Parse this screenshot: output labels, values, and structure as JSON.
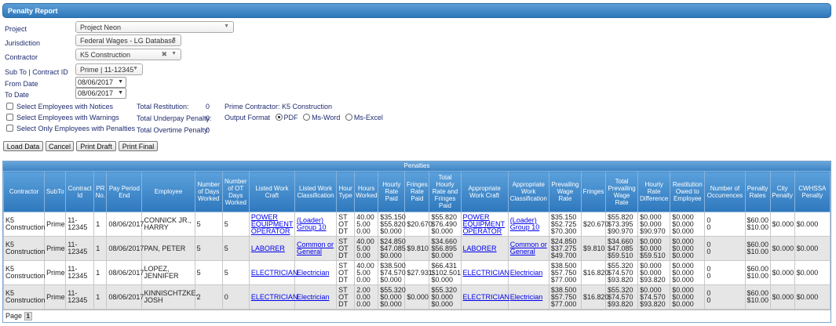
{
  "header": {
    "title": "Penalty Report"
  },
  "form": {
    "project": {
      "label": "Project",
      "value": "Project Neon"
    },
    "jurisdiction": {
      "label": "Jurisdiction",
      "value": "Federal Wages - LG Database"
    },
    "contractor": {
      "label": "Contractor",
      "value": "K5 Construction"
    },
    "subto": {
      "label": "Sub To | Contract ID",
      "value": "Prime | 11-12345"
    },
    "from_date": {
      "label": "From Date",
      "value": "08/06/2017"
    },
    "to_date": {
      "label": "To Date",
      "value": "08/06/2017"
    },
    "checks": [
      "Select Employees with Notices",
      "Select Employees with Warnings",
      "Select Only Employees with Penalties"
    ],
    "totals": [
      {
        "label": "Total Restitution:",
        "value": "0"
      },
      {
        "label": "Total Underpay Penalty:",
        "value": "0"
      },
      {
        "label": "Total Overtime Penalty:",
        "value": "0"
      }
    ],
    "prime_contractor": "Prime Contractor: K5 Construction",
    "output_format": {
      "label": "Output Format",
      "options": [
        "PDF",
        "Ms-Word",
        "Ms-Excel"
      ],
      "selected": "PDF"
    }
  },
  "buttons": {
    "load": "Load Data",
    "cancel": "Cancel",
    "print_draft": "Print Draft",
    "print_final": "Print Final"
  },
  "grid": {
    "title": "Penalties",
    "columns": [
      "Contractor",
      "SubTo",
      "Contract Id",
      "PR No.",
      "Pay Period End",
      "Employee",
      "Number of Days Worked",
      "Number of OT Days Worked",
      "Listed Work Craft",
      "Listed Work Classification",
      "Hour Type",
      "Hours Worked",
      "Hourly Rate Paid",
      "Fringes Rate Paid",
      "Total Hourly Rate and Fringes Paid",
      "Appropriate Work Craft",
      "Appropriate Work Classification",
      "Prevailing Wage Rate",
      "Fringes",
      "Total Prevailing Wage Rate",
      "Hourly Rate Difference",
      "Restitution Owed to Employee",
      "Number of Occurrences",
      "Penalty Rates",
      "City Penalty",
      "CWHSSA Penalty"
    ],
    "rows": [
      [
        "K5 Construction",
        "Prime",
        "11-12345",
        "1",
        "08/06/2017",
        "CONNICK JR., HARRY",
        "5",
        "5",
        "POWER EQUIPMENT OPERATOR",
        "(Loader) Group 10",
        "ST\nOT\nDT",
        "40.00\n5.00\n0.00",
        "$35.150\n$55.820\n$0.000",
        "$20.670",
        "$55.820\n$76.490\n$0.000",
        "POWER EQUIPMENT OPERATOR",
        "(Loader) Group 10",
        "$35.150\n$52.725\n$70.300",
        "$20.670",
        "$55.820\n$73.395\n$90.970",
        "$0.000\n$0.000\n$90.970",
        "$0.000\n$0.000\n$0.000",
        "0\n0",
        "$60.00\n$10.00",
        "$0.000",
        "$0.000"
      ],
      [
        "K5 Construction",
        "Prime",
        "11-12345",
        "1",
        "08/06/2017",
        "PAN, PETER",
        "5",
        "5",
        "LABORER",
        "Common or General",
        "ST\nOT\nDT",
        "40.00\n5.00\n0.00",
        "$24.850\n$47.085\n$0.000",
        "$9.810",
        "$34.660\n$56.895\n$0.000",
        "LABORER",
        "Common or General",
        "$24.850\n$37.275\n$49.700",
        "$9.810",
        "$34.660\n$47.085\n$59.510",
        "$0.000\n$0.000\n$59.510",
        "$0.000\n$0.000\n$0.000",
        "0\n0",
        "$60.00\n$10.00",
        "$0.000",
        "$0.000"
      ],
      [
        "K5 Construction",
        "Prime",
        "11-12345",
        "1",
        "08/06/2017",
        "LOPEZ, JENNIFER",
        "5",
        "5",
        "ELECTRICIAN",
        "Electrician",
        "ST\nOT\nDT",
        "40.00\n5.00\n0.00",
        "$38.500\n$74.570\n$0.000",
        "$27.931",
        "$66.431\n$102.501\n$0.000",
        "ELECTRICIAN",
        "Electrician",
        "$38.500\n$57.750\n$77.000",
        "$16.820",
        "$55.320\n$74.570\n$93.820",
        "$0.000\n$0.000\n$93.820",
        "$0.000\n$0.000\n$0.000",
        "0\n0",
        "$60.00\n$10.00",
        "$0.000",
        "$0.000"
      ],
      [
        "K5 Construction",
        "Prime",
        "11-12345",
        "1",
        "08/06/2017",
        "KINNISCHTZKE, JOSH",
        "2",
        "0",
        "ELECTRICIAN",
        "Electrician",
        "ST\nOT\nDT",
        "2.00\n0.00\n0.00",
        "$55.320\n$0.000\n$0.000",
        "$0.000",
        "$55.320\n$0.000\n$0.000",
        "ELECTRICIAN",
        "Electrician",
        "$38.500\n$57.750\n$77.000",
        "$16.820",
        "$55.320\n$74.570\n$93.820",
        "$0.000\n$74.570\n$93.820",
        "$0.000\n$0.000\n$0.000",
        "0\n0",
        "$60.00\n$10.00",
        "$0.000",
        "$0.000"
      ]
    ],
    "link_columns": [
      8,
      9,
      15,
      16
    ],
    "pager_label": "Page",
    "page": "1"
  }
}
